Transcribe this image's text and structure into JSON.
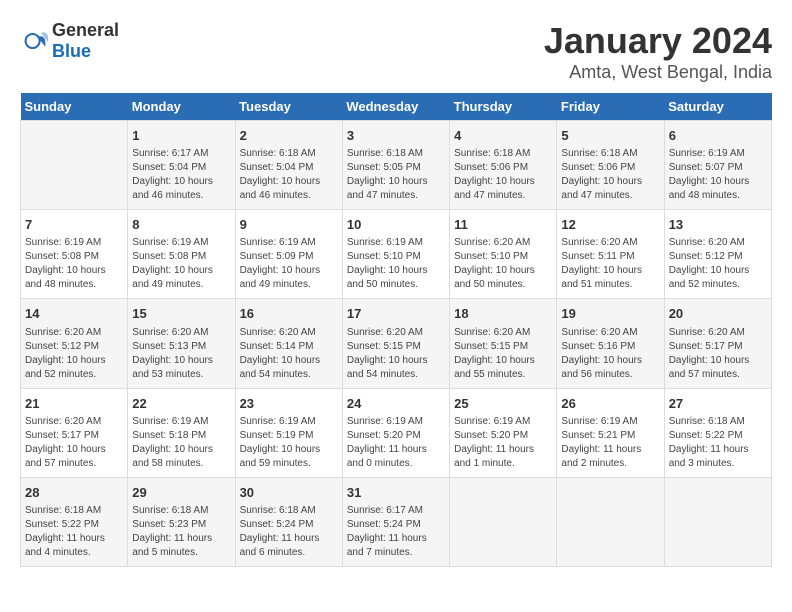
{
  "header": {
    "logo_general": "General",
    "logo_blue": "Blue",
    "title": "January 2024",
    "subtitle": "Amta, West Bengal, India"
  },
  "days_of_week": [
    "Sunday",
    "Monday",
    "Tuesday",
    "Wednesday",
    "Thursday",
    "Friday",
    "Saturday"
  ],
  "weeks": [
    [
      {
        "day": "",
        "info": ""
      },
      {
        "day": "1",
        "info": "Sunrise: 6:17 AM\nSunset: 5:04 PM\nDaylight: 10 hours\nand 46 minutes."
      },
      {
        "day": "2",
        "info": "Sunrise: 6:18 AM\nSunset: 5:04 PM\nDaylight: 10 hours\nand 46 minutes."
      },
      {
        "day": "3",
        "info": "Sunrise: 6:18 AM\nSunset: 5:05 PM\nDaylight: 10 hours\nand 47 minutes."
      },
      {
        "day": "4",
        "info": "Sunrise: 6:18 AM\nSunset: 5:06 PM\nDaylight: 10 hours\nand 47 minutes."
      },
      {
        "day": "5",
        "info": "Sunrise: 6:18 AM\nSunset: 5:06 PM\nDaylight: 10 hours\nand 47 minutes."
      },
      {
        "day": "6",
        "info": "Sunrise: 6:19 AM\nSunset: 5:07 PM\nDaylight: 10 hours\nand 48 minutes."
      }
    ],
    [
      {
        "day": "7",
        "info": "Sunrise: 6:19 AM\nSunset: 5:08 PM\nDaylight: 10 hours\nand 48 minutes."
      },
      {
        "day": "8",
        "info": "Sunrise: 6:19 AM\nSunset: 5:08 PM\nDaylight: 10 hours\nand 49 minutes."
      },
      {
        "day": "9",
        "info": "Sunrise: 6:19 AM\nSunset: 5:09 PM\nDaylight: 10 hours\nand 49 minutes."
      },
      {
        "day": "10",
        "info": "Sunrise: 6:19 AM\nSunset: 5:10 PM\nDaylight: 10 hours\nand 50 minutes."
      },
      {
        "day": "11",
        "info": "Sunrise: 6:20 AM\nSunset: 5:10 PM\nDaylight: 10 hours\nand 50 minutes."
      },
      {
        "day": "12",
        "info": "Sunrise: 6:20 AM\nSunset: 5:11 PM\nDaylight: 10 hours\nand 51 minutes."
      },
      {
        "day": "13",
        "info": "Sunrise: 6:20 AM\nSunset: 5:12 PM\nDaylight: 10 hours\nand 52 minutes."
      }
    ],
    [
      {
        "day": "14",
        "info": "Sunrise: 6:20 AM\nSunset: 5:12 PM\nDaylight: 10 hours\nand 52 minutes."
      },
      {
        "day": "15",
        "info": "Sunrise: 6:20 AM\nSunset: 5:13 PM\nDaylight: 10 hours\nand 53 minutes."
      },
      {
        "day": "16",
        "info": "Sunrise: 6:20 AM\nSunset: 5:14 PM\nDaylight: 10 hours\nand 54 minutes."
      },
      {
        "day": "17",
        "info": "Sunrise: 6:20 AM\nSunset: 5:15 PM\nDaylight: 10 hours\nand 54 minutes."
      },
      {
        "day": "18",
        "info": "Sunrise: 6:20 AM\nSunset: 5:15 PM\nDaylight: 10 hours\nand 55 minutes."
      },
      {
        "day": "19",
        "info": "Sunrise: 6:20 AM\nSunset: 5:16 PM\nDaylight: 10 hours\nand 56 minutes."
      },
      {
        "day": "20",
        "info": "Sunrise: 6:20 AM\nSunset: 5:17 PM\nDaylight: 10 hours\nand 57 minutes."
      }
    ],
    [
      {
        "day": "21",
        "info": "Sunrise: 6:20 AM\nSunset: 5:17 PM\nDaylight: 10 hours\nand 57 minutes."
      },
      {
        "day": "22",
        "info": "Sunrise: 6:19 AM\nSunset: 5:18 PM\nDaylight: 10 hours\nand 58 minutes."
      },
      {
        "day": "23",
        "info": "Sunrise: 6:19 AM\nSunset: 5:19 PM\nDaylight: 10 hours\nand 59 minutes."
      },
      {
        "day": "24",
        "info": "Sunrise: 6:19 AM\nSunset: 5:20 PM\nDaylight: 11 hours\nand 0 minutes."
      },
      {
        "day": "25",
        "info": "Sunrise: 6:19 AM\nSunset: 5:20 PM\nDaylight: 11 hours\nand 1 minute."
      },
      {
        "day": "26",
        "info": "Sunrise: 6:19 AM\nSunset: 5:21 PM\nDaylight: 11 hours\nand 2 minutes."
      },
      {
        "day": "27",
        "info": "Sunrise: 6:18 AM\nSunset: 5:22 PM\nDaylight: 11 hours\nand 3 minutes."
      }
    ],
    [
      {
        "day": "28",
        "info": "Sunrise: 6:18 AM\nSunset: 5:22 PM\nDaylight: 11 hours\nand 4 minutes."
      },
      {
        "day": "29",
        "info": "Sunrise: 6:18 AM\nSunset: 5:23 PM\nDaylight: 11 hours\nand 5 minutes."
      },
      {
        "day": "30",
        "info": "Sunrise: 6:18 AM\nSunset: 5:24 PM\nDaylight: 11 hours\nand 6 minutes."
      },
      {
        "day": "31",
        "info": "Sunrise: 6:17 AM\nSunset: 5:24 PM\nDaylight: 11 hours\nand 7 minutes."
      },
      {
        "day": "",
        "info": ""
      },
      {
        "day": "",
        "info": ""
      },
      {
        "day": "",
        "info": ""
      }
    ]
  ]
}
